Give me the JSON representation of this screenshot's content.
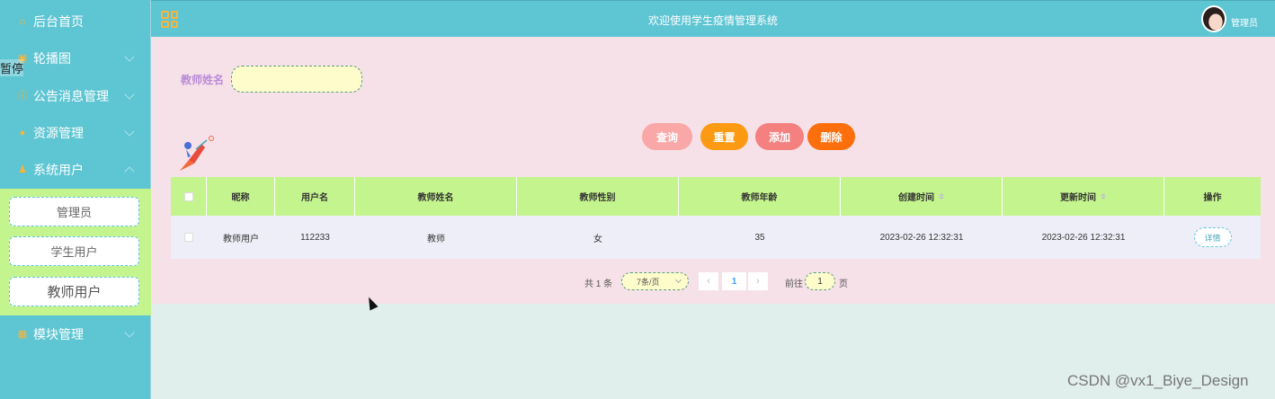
{
  "sidebar": {
    "items": [
      {
        "label": "后台首页",
        "icon": "home-icon",
        "expanded": false
      },
      {
        "label": "轮播图",
        "icon": "image-icon",
        "expanded": false
      },
      {
        "label": "公告消息管理",
        "icon": "info-icon",
        "expanded": false
      },
      {
        "label": "资源管理",
        "icon": "location-icon",
        "expanded": false
      },
      {
        "label": "系统用户",
        "icon": "user-icon",
        "expanded": true
      },
      {
        "label": "模块管理",
        "icon": "grid-icon",
        "expanded": false
      }
    ],
    "submenu": [
      "管理员",
      "学生用户",
      "教师用户"
    ],
    "active_submenu": "教师用户",
    "overlay_text": "暂停"
  },
  "header": {
    "title": "欢迎使用学生疫情管理系统",
    "user": "管理员"
  },
  "search": {
    "label": "教师姓名",
    "value": ""
  },
  "actions": {
    "query": "查询",
    "reset": "重置",
    "add": "添加",
    "delete": "删除"
  },
  "table": {
    "columns": [
      "昵称",
      "用户名",
      "教师姓名",
      "教师性别",
      "教师年龄",
      "创建时间",
      "更新时间",
      "操作"
    ],
    "rows": [
      {
        "nickname": "教师用户",
        "username": "112233",
        "name": "教师",
        "gender": "女",
        "age": "35",
        "created": "2023-02-26 12:32:31",
        "updated": "2023-02-26 12:32:31",
        "action": "详情"
      }
    ]
  },
  "pagination": {
    "total": "共 1 条",
    "page_size": "7条/页",
    "prev": "‹",
    "current": "1",
    "next": "›",
    "goto_label": "前往",
    "goto_value": "1",
    "page_suffix": "页"
  },
  "watermark": "CSDN @vx1_Biye_Design",
  "colors": {
    "sidebar": "#5ec5d3",
    "panel": "#f5e1e7",
    "table_header": "#c4f48d",
    "accent_orange": "#fd9a13"
  }
}
